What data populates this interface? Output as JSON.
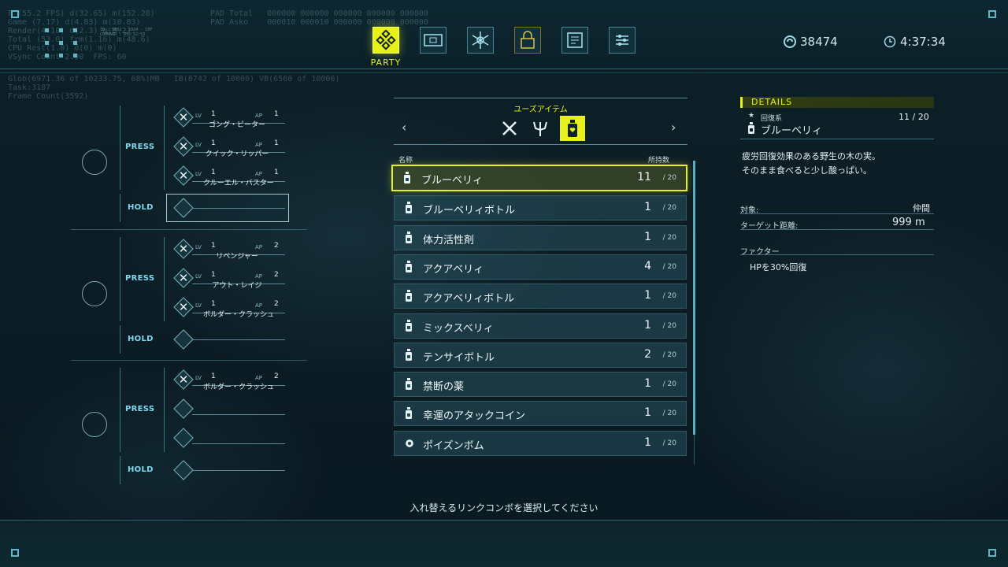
{
  "debug": {
    "top_left": "F (55.2 FPS) d(32.65) m(152.28)\nGame (7.17) d(4.83) m(10.83)\nRender(4.10) d(2.3) m(8.2)\nTotal (53.0) frm(1.16) m(48.6)\nCPU Rest(1.0) d(0) m(0)\nVSync Count 2.00  FPS: 60",
    "top_tiny": "ID : 5002 : 1024 - CPP\nCOMMAND : 052:52:53",
    "pad": "PAD Total   000000 000000 000000 000000 000000\nPAD Asko    000010 000010 000000 000000 000000",
    "mem": "Glob(6971.36 of 10233.75, 68%)MB   IB(8742 of 10000) VB(6560 of 10000)\nTask:3107\nFrame Count(3592)"
  },
  "header": {
    "nav_label": "PARTY",
    "nav_items": [
      "party-icon",
      "cards-icon",
      "network-icon",
      "lock-icon",
      "document-icon",
      "settings-icon"
    ],
    "currency": "38474",
    "time": "4:37:34"
  },
  "combos": {
    "press_label": "PRESS",
    "hold_label": "HOLD",
    "lv_label": "LV",
    "ap_label": "AP",
    "groups": [
      {
        "skills": [
          {
            "name": "ゴング・ビーター",
            "lv": "1",
            "ap": "1"
          },
          {
            "name": "クイック・リッパー",
            "lv": "1",
            "ap": "1"
          },
          {
            "name": "クルーエル・バスター",
            "lv": "1",
            "ap": "1"
          }
        ]
      },
      {
        "skills": [
          {
            "name": "リベンジャー",
            "lv": "1",
            "ap": "2"
          },
          {
            "name": "アウト・レイジ",
            "lv": "1",
            "ap": "2"
          },
          {
            "name": "ボルダー・クラッシュ",
            "lv": "1",
            "ap": "2"
          }
        ]
      },
      {
        "skills": [
          {
            "name": "ボルダー・クラッシュ",
            "lv": "1",
            "ap": "2"
          }
        ]
      }
    ]
  },
  "items_panel": {
    "title": "ユーズアイテム",
    "col_name": "名称",
    "col_count": "所持数",
    "categories": [
      "swords-icon",
      "trident-icon",
      "potion-icon"
    ],
    "items": [
      {
        "name": "ブルーベリィ",
        "count": "11",
        "max": "/ 20",
        "icon": "bottle-icon"
      },
      {
        "name": "ブルーベリィボトル",
        "count": "1",
        "max": "/ 20",
        "icon": "bottle-icon"
      },
      {
        "name": "体力活性剤",
        "count": "1",
        "max": "/ 20",
        "icon": "bottle-icon"
      },
      {
        "name": "アクアベリィ",
        "count": "4",
        "max": "/ 20",
        "icon": "bottle-icon"
      },
      {
        "name": "アクアベリィボトル",
        "count": "1",
        "max": "/ 20",
        "icon": "bottle-icon"
      },
      {
        "name": "ミックスベリィ",
        "count": "1",
        "max": "/ 20",
        "icon": "bottle-icon"
      },
      {
        "name": "テンサイボトル",
        "count": "2",
        "max": "/ 20",
        "icon": "bottle-icon"
      },
      {
        "name": "禁断の薬",
        "count": "1",
        "max": "/ 20",
        "icon": "bottle-icon"
      },
      {
        "name": "幸運のアタックコイン",
        "count": "1",
        "max": "/ 20",
        "icon": "bottle-icon"
      },
      {
        "name": "ポイズンボム",
        "count": "1",
        "max": "/ 20",
        "icon": "bomb-icon"
      }
    ],
    "hint": "入れ替えるリンクコンボを選択してください"
  },
  "details": {
    "title": "DETAILS",
    "category": "回復系",
    "stock": "11 / 20",
    "name": "ブルーベリィ",
    "desc1": "疲労回復効果のある野生の木の実。",
    "desc2": "そのまま食べると少し酸っぱい。",
    "target_label": "対象:",
    "target_value": "仲間",
    "range_label": "ターゲット距離:",
    "range_value": "999 m",
    "factor_label": "ファクター",
    "factor_value": "HPを30%回復"
  },
  "colors": {
    "accent": "#e6f21a",
    "cyan": "#7dd9ee",
    "bg": "#0c1c24"
  }
}
